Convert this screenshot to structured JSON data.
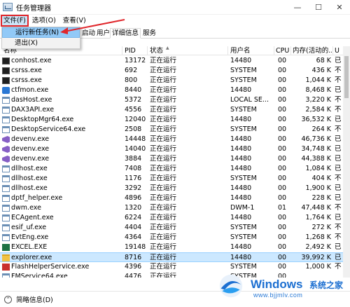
{
  "window": {
    "title": "任务管理器",
    "min_label": "—",
    "max_label": "☐",
    "close_label": "✕"
  },
  "menubar": {
    "file": "文件(F)",
    "options": "选项(O)",
    "view": "查看(V)"
  },
  "file_menu": {
    "items": [
      "运行新任务(N)",
      "退出(X)"
    ]
  },
  "tabs": [
    "启动",
    "用户",
    "详细信息",
    "服务"
  ],
  "active_tab": "详细信息",
  "columns": {
    "name": "名称",
    "pid": "PID",
    "status": "状态",
    "user": "用户名",
    "cpu": "CPU",
    "memory": "内存(活动的...",
    "uac": "U"
  },
  "processes": [
    {
      "name": "conhost.exe",
      "pid": "13172",
      "status": "正在运行",
      "user": "14480",
      "cpu": "00",
      "memory": "68 K",
      "uac": "已",
      "icon": "console-icon"
    },
    {
      "name": "csrss.exe",
      "pid": "692",
      "status": "正在运行",
      "user": "SYSTEM",
      "cpu": "00",
      "memory": "436 K",
      "uac": "不",
      "icon": "console-icon"
    },
    {
      "name": "csrss.exe",
      "pid": "800",
      "status": "正在运行",
      "user": "SYSTEM",
      "cpu": "00",
      "memory": "1,044 K",
      "uac": "不",
      "icon": "console-icon"
    },
    {
      "name": "ctfmon.exe",
      "pid": "8440",
      "status": "正在运行",
      "user": "14480",
      "cpu": "00",
      "memory": "8,468 K",
      "uac": "已",
      "icon": "ctfmon-icon"
    },
    {
      "name": "dasHost.exe",
      "pid": "5372",
      "status": "正在运行",
      "user": "LOCAL SE...",
      "cpu": "00",
      "memory": "3,220 K",
      "uac": "不",
      "icon": "window-icon"
    },
    {
      "name": "DAX3API.exe",
      "pid": "4556",
      "status": "正在运行",
      "user": "SYSTEM",
      "cpu": "00",
      "memory": "2,584 K",
      "uac": "不",
      "icon": "window-icon"
    },
    {
      "name": "DesktopMgr64.exe",
      "pid": "12040",
      "status": "正在运行",
      "user": "14480",
      "cpu": "00",
      "memory": "36,532 K",
      "uac": "已",
      "icon": "window-icon"
    },
    {
      "name": "DesktopService64.exe",
      "pid": "2508",
      "status": "正在运行",
      "user": "SYSTEM",
      "cpu": "00",
      "memory": "264 K",
      "uac": "不",
      "icon": "window-icon"
    },
    {
      "name": "devenv.exe",
      "pid": "14448",
      "status": "正在运行",
      "user": "14480",
      "cpu": "00",
      "memory": "46,736 K",
      "uac": "已",
      "icon": "visual-studio-icon"
    },
    {
      "name": "devenv.exe",
      "pid": "14040",
      "status": "正在运行",
      "user": "14480",
      "cpu": "00",
      "memory": "34,748 K",
      "uac": "已",
      "icon": "visual-studio-icon"
    },
    {
      "name": "devenv.exe",
      "pid": "3884",
      "status": "正在运行",
      "user": "14480",
      "cpu": "00",
      "memory": "44,388 K",
      "uac": "已",
      "icon": "visual-studio-icon"
    },
    {
      "name": "dllhost.exe",
      "pid": "7408",
      "status": "正在运行",
      "user": "14480",
      "cpu": "00",
      "memory": "1,084 K",
      "uac": "已",
      "icon": "window-icon"
    },
    {
      "name": "dllhost.exe",
      "pid": "1176",
      "status": "正在运行",
      "user": "SYSTEM",
      "cpu": "00",
      "memory": "404 K",
      "uac": "不",
      "icon": "window-icon"
    },
    {
      "name": "dllhost.exe",
      "pid": "3292",
      "status": "正在运行",
      "user": "14480",
      "cpu": "00",
      "memory": "1,900 K",
      "uac": "已",
      "icon": "window-icon"
    },
    {
      "name": "dptf_helper.exe",
      "pid": "4896",
      "status": "正在运行",
      "user": "14480",
      "cpu": "00",
      "memory": "228 K",
      "uac": "已",
      "icon": "window-icon"
    },
    {
      "name": "dwm.exe",
      "pid": "1320",
      "status": "正在运行",
      "user": "DWM-1",
      "cpu": "01",
      "memory": "47,448 K",
      "uac": "不",
      "icon": "window-icon"
    },
    {
      "name": "ECAgent.exe",
      "pid": "6224",
      "status": "正在运行",
      "user": "14480",
      "cpu": "00",
      "memory": "1,764 K",
      "uac": "已",
      "icon": "window-icon"
    },
    {
      "name": "esif_uf.exe",
      "pid": "4404",
      "status": "正在运行",
      "user": "SYSTEM",
      "cpu": "00",
      "memory": "272 K",
      "uac": "不",
      "icon": "window-icon"
    },
    {
      "name": "EvtEng.exe",
      "pid": "4364",
      "status": "正在运行",
      "user": "SYSTEM",
      "cpu": "00",
      "memory": "1,268 K",
      "uac": "不",
      "icon": "window-icon"
    },
    {
      "name": "EXCEL.EXE",
      "pid": "19148",
      "status": "正在运行",
      "user": "14480",
      "cpu": "00",
      "memory": "2,492 K",
      "uac": "已",
      "icon": "excel-icon"
    },
    {
      "name": "explorer.exe",
      "pid": "8716",
      "status": "正在运行",
      "user": "14480",
      "cpu": "00",
      "memory": "39,992 K",
      "uac": "已",
      "icon": "folder-icon",
      "selected": true
    },
    {
      "name": "FlashHelperService.exe",
      "pid": "4396",
      "status": "正在运行",
      "user": "SYSTEM",
      "cpu": "00",
      "memory": "1,000 K",
      "uac": "不",
      "icon": "flash-icon"
    },
    {
      "name": "FMService64.exe",
      "pid": "4476",
      "status": "正在运行",
      "user": "SYSTEM",
      "cpu": "00",
      "memory": "",
      "uac": "",
      "icon": "window-icon"
    }
  ],
  "footer": {
    "label": "简略信息(D)"
  },
  "watermark": {
    "title": "Windows",
    "subtitle": "系统之家",
    "url": "www.bjjmlv.com"
  },
  "colors": {
    "highlight_red": "#e0262b",
    "selection": "#cce8ff",
    "menu_highlight": "#91c9f7",
    "watermark_blue": "#1c6fd1"
  }
}
